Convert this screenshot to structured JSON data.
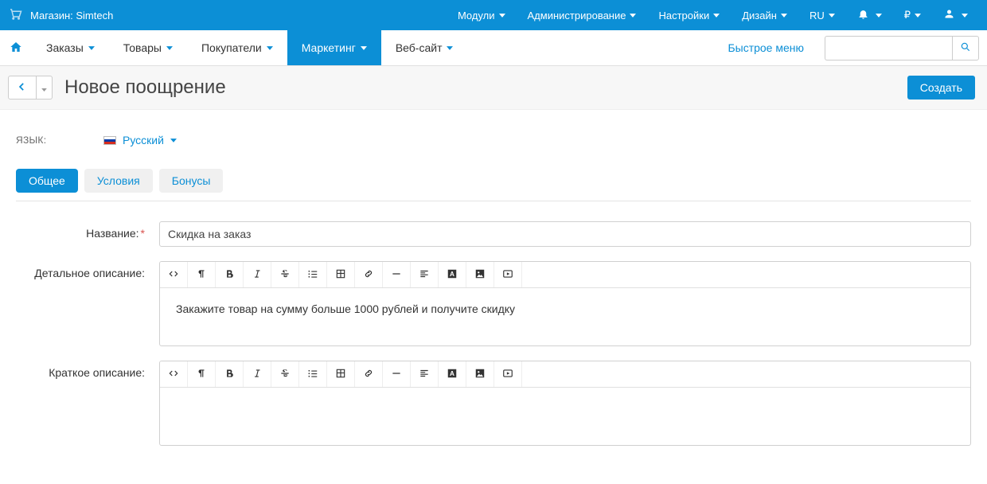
{
  "topbar": {
    "store_label": "Магазин: Simtech",
    "menu": {
      "modules": "Модули",
      "admin": "Администрирование",
      "settings": "Настройки",
      "design": "Дизайн",
      "lang": "RU",
      "currency": "₽"
    }
  },
  "navbar": {
    "orders": "Заказы",
    "products": "Товары",
    "customers": "Покупатели",
    "marketing": "Маркетинг",
    "website": "Веб-сайт",
    "quick_menu": "Быстрое меню",
    "search_placeholder": ""
  },
  "titlebar": {
    "page_title": "Новое поощрение",
    "create_btn": "Создать"
  },
  "lang_section": {
    "label": "ЯЗЫК:",
    "value": "Русский"
  },
  "tabs": {
    "general": "Общее",
    "conditions": "Условия",
    "bonuses": "Бонусы"
  },
  "form": {
    "name_label": "Название:",
    "name_value": "Скидка на заказ",
    "detailed_label": "Детальное описание:",
    "detailed_value": "Закажите товар на сумму больше 1000 рублей и получите скидку",
    "short_label": "Краткое описание:",
    "short_value": ""
  }
}
